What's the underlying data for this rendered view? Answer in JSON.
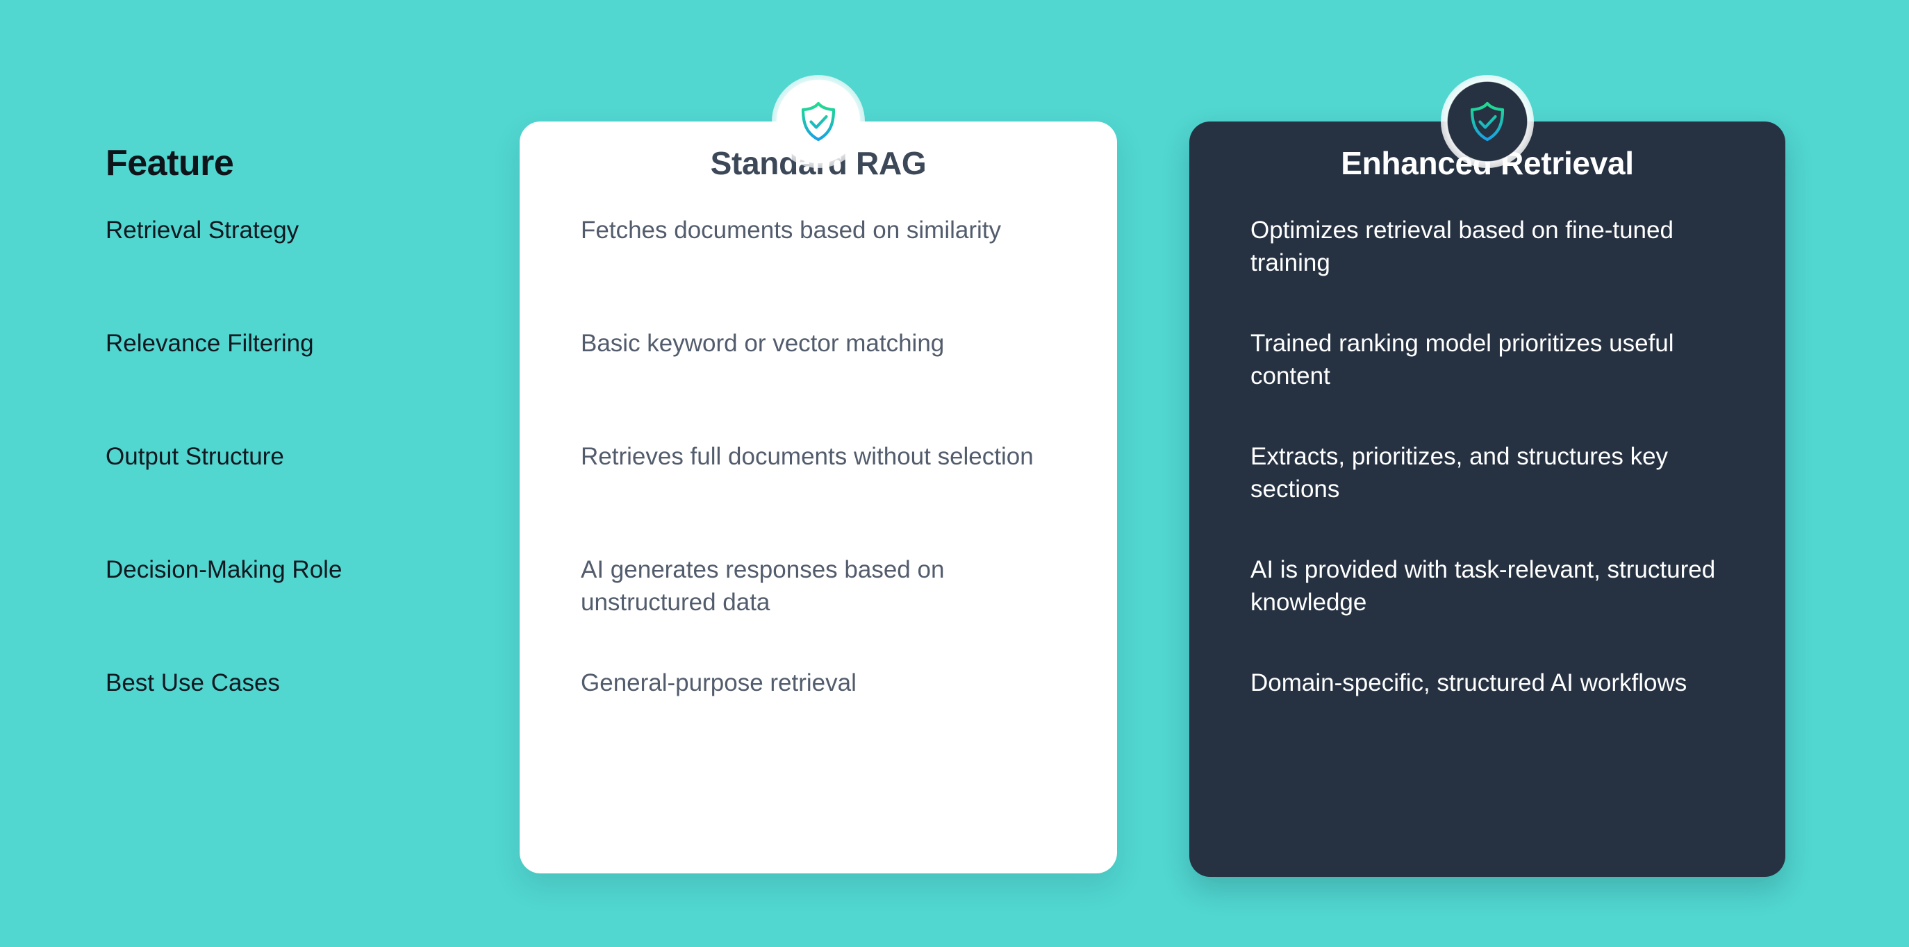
{
  "theme": {
    "background_color": "#51d6d0",
    "light_card_color": "#ffffff",
    "dark_card_color": "#263242",
    "light_card_title_color": "#3c4858",
    "light_card_body_color": "#525c6c",
    "dark_card_text_color": "#ffffff",
    "feature_heading_color": "#0e1419",
    "icon_gradient_start": "#22dd8e",
    "icon_gradient_end": "#1a9fe8"
  },
  "feature_column": {
    "heading": "Feature",
    "rows": [
      "Retrieval Strategy",
      "Relevance Filtering",
      "Output Structure",
      "Decision-Making Role",
      "Best Use Cases"
    ]
  },
  "cards": [
    {
      "title": "Standard RAG",
      "icon": "shield-check-icon",
      "rows": [
        "Fetches documents based on similarity",
        "Basic keyword or vector matching",
        "Retrieves full documents without selection",
        "AI generates responses based on unstructured data",
        "General-purpose retrieval"
      ]
    },
    {
      "title": "Enhanced Retrieval",
      "icon": "shield-check-icon",
      "rows": [
        "Optimizes retrieval based on fine-tuned training",
        "Trained ranking model prioritizes useful content",
        "Extracts, prioritizes, and structures key sections",
        "AI is provided with task-relevant, structured knowledge",
        "Domain-specific, structured AI workflows"
      ]
    }
  ]
}
